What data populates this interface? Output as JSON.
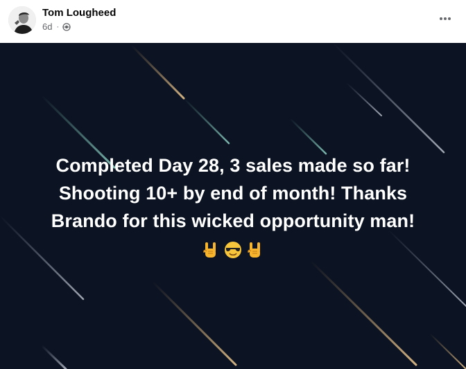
{
  "post": {
    "author": "Tom Lougheed",
    "timestamp": "6d",
    "separator": "·",
    "privacy_icon": "globe-icon",
    "more_icon": "more-options-icon",
    "text_lines": [
      "Completed Day 28, 3 sales made so far!",
      "Shooting 10+ by end of month! Thanks",
      "Brando for this wicked opportunity man!"
    ],
    "emojis": [
      "rock-on-hand-icon",
      "sunglasses-face-icon",
      "rock-on-hand-icon"
    ]
  },
  "colors": {
    "background_dark": "#0c1322",
    "text_primary": "#050505",
    "text_secondary": "#65676b"
  }
}
